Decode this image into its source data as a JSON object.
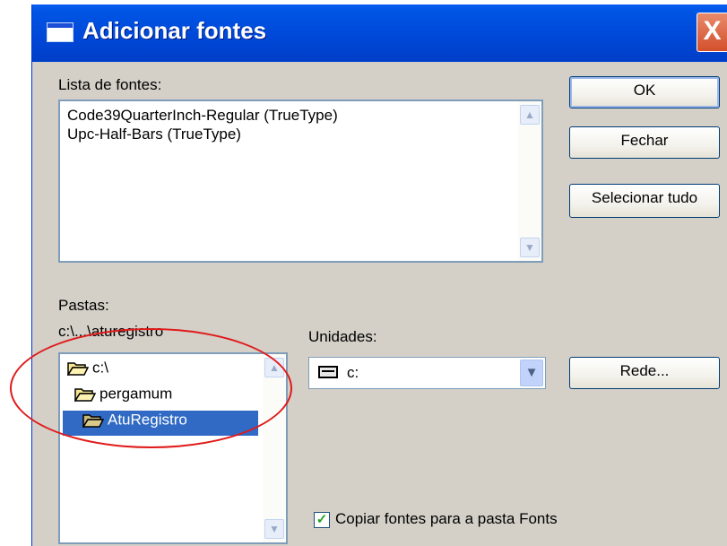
{
  "window": {
    "title": "Adicionar fontes",
    "close_label": "X"
  },
  "font_list": {
    "label": "Lista de fontes:",
    "items": [
      "Code39QuarterInch-Regular (TrueType)",
      "Upc-Half-Bars (TrueType)"
    ]
  },
  "buttons": {
    "ok": "OK",
    "close": "Fechar",
    "select_all": "Selecionar tudo",
    "network": "Rede..."
  },
  "folders": {
    "label": "Pastas:",
    "current_path": "c:\\...\\aturegistro",
    "tree": [
      {
        "label": "c:\\",
        "level": 0,
        "selected": false
      },
      {
        "label": "pergamum",
        "level": 1,
        "selected": false
      },
      {
        "label": "AtuRegistro",
        "level": 2,
        "selected": true
      }
    ]
  },
  "drives": {
    "label": "Unidades:",
    "selected": "c:"
  },
  "copy_fonts": {
    "label": "Copiar fontes para a pasta Fonts",
    "checked": true
  },
  "colors": {
    "titlebar": "#0055e5",
    "selection": "#316ac5",
    "dialog_bg": "#d4d0c8",
    "annotation": "#e01a1a"
  },
  "icons": [
    "window-icon",
    "close-icon",
    "folder-open-icon",
    "drive-icon",
    "chevron-down-icon",
    "scroll-up-icon",
    "scroll-down-icon",
    "checkmark-icon"
  ]
}
